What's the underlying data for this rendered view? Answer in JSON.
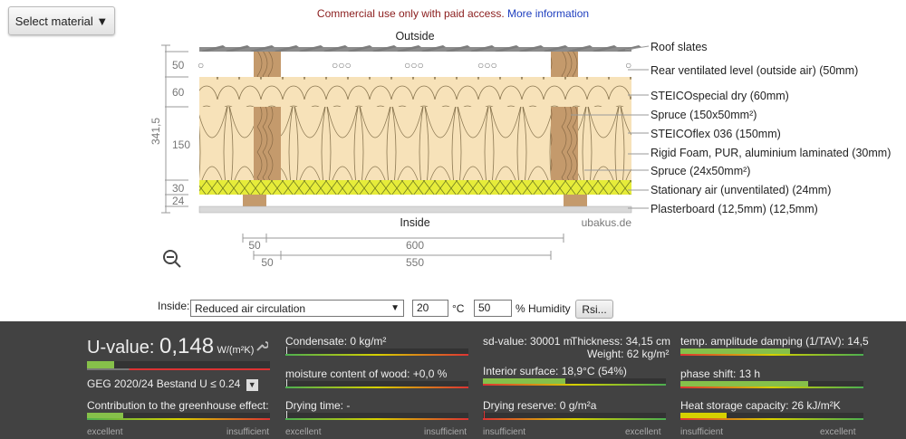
{
  "toolbar": {
    "select_material_label": "Select material ▼"
  },
  "notice": {
    "text": "Commercial use only with paid access.",
    "link": "More information"
  },
  "diagram": {
    "outside_label": "Outside",
    "inside_label": "Inside",
    "watermark": "ubakus.de",
    "total_thickness": "341,5",
    "layer_thicknesses": [
      "50",
      "60",
      "150",
      "30",
      "24"
    ],
    "bottom_dims_top": [
      "50",
      "600"
    ],
    "bottom_dims_bottom": [
      "50",
      "550"
    ],
    "layers": [
      "Roof slates",
      "Rear ventilated level (outside air) (50mm)",
      "STEICOspecial dry (60mm)",
      "Spruce (150x50mm²)",
      "STEICOflex 036 (150mm)",
      "Rigid Foam, PUR, aluminium laminated (30mm)",
      "Spruce (24x50mm²)",
      "Stationary air (unventilated) (24mm)",
      "Plasterboard (12,5mm) (12,5mm)"
    ],
    "vent_marks": [
      "○",
      "○○○",
      "○○○",
      "○○○",
      "○"
    ]
  },
  "inside_controls": {
    "label": "Inside:",
    "circulation": "Reduced air circulation",
    "temperature": "20",
    "temperature_unit": "°C",
    "humidity": "50",
    "humidity_unit": "% Humidity",
    "rsi_label": "Rsi..."
  },
  "results": {
    "u_label": "U-value: ",
    "u_value": "0,148",
    "u_unit": "W/(m²K)",
    "u_fraction": 0.15,
    "geg": "GEG 2020/24 Bestand U ≤ 0.24",
    "greenhouse": "Contribution to the greenhouse effect:",
    "greenhouse_fraction": 0.2,
    "condensate": "Condensate: 0 kg/m²",
    "moisture": "moisture content of wood: +0,0 %",
    "drying_time": "Drying time: -",
    "sd_value": "sd-value: 30001 m",
    "thickness": "Thickness: 34,15 cm",
    "weight": "Weight: 62 kg/m²",
    "interior_surface": "Interior surface: 18,9°C (54%)",
    "interior_fraction": 0.45,
    "drying_reserve": "Drying reserve: 0 g/m²a",
    "damping": "temp. amplitude damping (1/TAV): 14,5",
    "damping_fraction": 0.6,
    "phase_shift": "phase shift: 13 h",
    "phase_fraction": 0.7,
    "heat_storage": "Heat storage capacity: 26 kJ/m²K",
    "heat_fraction": 0.25,
    "scale_excellent": "excellent",
    "scale_insufficient": "insufficient"
  },
  "colors": {
    "wood": "#c49a6c",
    "insulation": "#f7e2b9",
    "foam": "#e6ec3a",
    "panel": "#424242"
  }
}
